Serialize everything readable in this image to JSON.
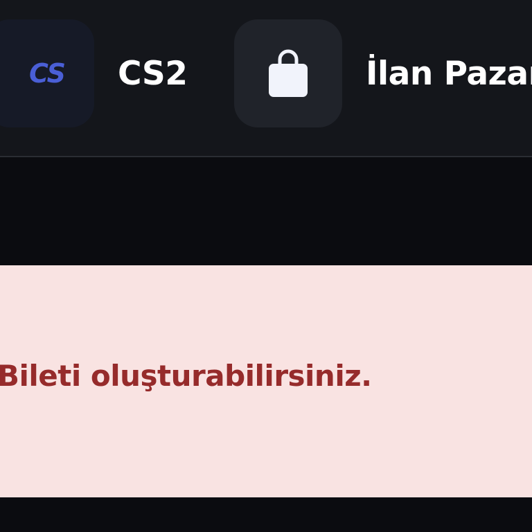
{
  "nav": {
    "items": [
      {
        "label": "CS2",
        "logo_text": "CS",
        "icon": "cs2-logo-icon"
      },
      {
        "label": "İlan Pazarı",
        "icon": "shopping-bag-icon"
      }
    ]
  },
  "alert": {
    "message": "Bileti oluşturabilirsiniz."
  },
  "colors": {
    "nav_background": "#14161b",
    "page_background": "#0b0c10",
    "alert_background": "#f9e3e2",
    "alert_text": "#962b2b",
    "cs2_logo": "#4a5fd6"
  }
}
